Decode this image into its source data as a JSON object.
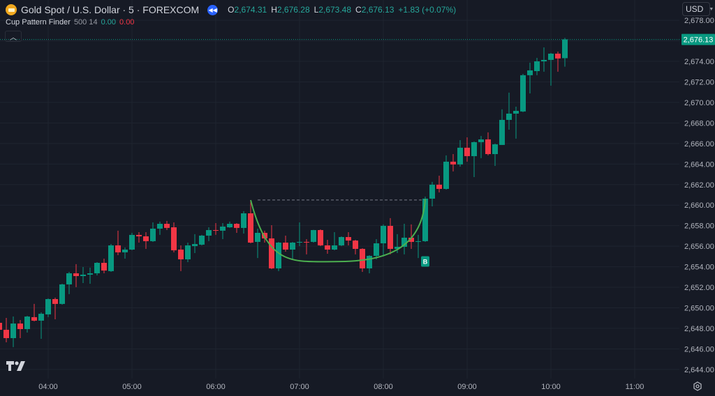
{
  "header": {
    "symbol_title": "Gold Spot / U.S. Dollar · 5 · FOREXCOM",
    "symbol_icon": "gold-bars-icon",
    "replay_icon": "rewind-icon",
    "ohlc": {
      "o_label": "O",
      "o": "2,674.31",
      "h_label": "H",
      "h": "2,676.28",
      "l_label": "L",
      "l": "2,673.48",
      "c_label": "C",
      "c": "2,676.13",
      "change": "+1.83 (+0.07%)"
    }
  },
  "indicator": {
    "name": "Cup Pattern Finder",
    "params": "500 14",
    "value1": "0.00",
    "value2": "0.00"
  },
  "currency_button": "USD",
  "colors": {
    "background": "#161a25",
    "up": "#089981",
    "down": "#f23645",
    "cup": "#4caf50",
    "grid": "#1f2430",
    "text": "#b2b5be"
  },
  "chart_data": {
    "type": "candlestick",
    "title": "",
    "timeframe": "5",
    "x_tick_labels": [
      "04:00",
      "05:00",
      "06:00",
      "07:00",
      "08:00",
      "09:00",
      "10:00",
      "11:00"
    ],
    "y_tick_labels": [
      "2,644.00",
      "2,646.00",
      "2,648.00",
      "2,650.00",
      "2,652.00",
      "2,654.00",
      "2,656.00",
      "2,658.00",
      "2,660.00",
      "2,662.00",
      "2,664.00",
      "2,666.00",
      "2,668.00",
      "2,670.00",
      "2,672.00",
      "2,674.00",
      "2,676.00",
      "2,678.00"
    ],
    "ylim": [
      2643,
      2678.5
    ],
    "grid": true,
    "last_price": 2676.13,
    "last_price_label": "2,676.13",
    "candles_fields": [
      "time",
      "open",
      "high",
      "low",
      "close"
    ],
    "candles": [
      [
        "03:25",
        2648.54,
        2648.75,
        2647.66,
        2647.86
      ],
      [
        "03:30",
        2647.86,
        2649.02,
        2646.64,
        2647.05
      ],
      [
        "03:35",
        2647.05,
        2649.15,
        2646.17,
        2648.47
      ],
      [
        "03:40",
        2648.47,
        2648.81,
        2647.05,
        2647.93
      ],
      [
        "03:45",
        2647.93,
        2649.22,
        2647.59,
        2649.15
      ],
      [
        "03:50",
        2649.09,
        2650.38,
        2648.68,
        2648.75
      ],
      [
        "03:55",
        2648.75,
        2649.56,
        2646.98,
        2649.42
      ],
      [
        "04:00",
        2649.36,
        2650.92,
        2649.09,
        2650.85
      ],
      [
        "04:05",
        2650.85,
        2650.99,
        2648.88,
        2650.38
      ],
      [
        "04:10",
        2650.38,
        2652.34,
        2650.31,
        2652.28
      ],
      [
        "04:15",
        2652.28,
        2653.5,
        2651.33,
        2653.36
      ],
      [
        "04:20",
        2653.36,
        2654.25,
        2652.01,
        2653.09
      ],
      [
        "04:25",
        2653.09,
        2653.97,
        2652.41,
        2653.23
      ],
      [
        "04:30",
        2653.23,
        2653.91,
        2652.34,
        2653.36
      ],
      [
        "04:35",
        2653.36,
        2654.45,
        2653.16,
        2654.38
      ],
      [
        "04:40",
        2654.38,
        2654.79,
        2653.36,
        2653.63
      ],
      [
        "04:45",
        2653.57,
        2656.21,
        2653.5,
        2656.08
      ],
      [
        "04:50",
        2656.08,
        2657.51,
        2655.13,
        2655.4
      ],
      [
        "04:55",
        2655.4,
        2655.88,
        2654.79,
        2655.67
      ],
      [
        "05:00",
        2655.67,
        2657.3,
        2655.6,
        2657.1
      ],
      [
        "05:05",
        2657.1,
        2657.37,
        2656.35,
        2656.96
      ],
      [
        "05:10",
        2656.96,
        2657.37,
        2655.74,
        2656.49
      ],
      [
        "05:15",
        2656.49,
        2658.32,
        2656.42,
        2657.71
      ],
      [
        "05:20",
        2657.71,
        2658.39,
        2657.1,
        2658.18
      ],
      [
        "05:25",
        2658.18,
        2658.46,
        2657.57,
        2657.78
      ],
      [
        "05:30",
        2657.84,
        2658.32,
        2655.4,
        2655.6
      ],
      [
        "05:35",
        2655.67,
        2656.08,
        2653.57,
        2654.72
      ],
      [
        "05:40",
        2654.72,
        2656.35,
        2654.45,
        2656.08
      ],
      [
        "05:45",
        2656.01,
        2657.17,
        2655.33,
        2656.21
      ],
      [
        "05:50",
        2656.15,
        2657.1,
        2656.08,
        2657.03
      ],
      [
        "05:55",
        2657.03,
        2657.84,
        2656.49,
        2657.57
      ],
      [
        "06:00",
        2657.57,
        2658.25,
        2657.1,
        2657.53
      ],
      [
        "06:05",
        2657.51,
        2658.25,
        2656.69,
        2657.91
      ],
      [
        "06:10",
        2657.84,
        2658.39,
        2657.78,
        2658.18
      ],
      [
        "06:15",
        2658.18,
        2658.25,
        2657.3,
        2657.78
      ],
      [
        "06:20",
        2657.78,
        2659.41,
        2657.23,
        2659.2
      ],
      [
        "06:25",
        2659.2,
        2660.49,
        2656.28,
        2656.35
      ],
      [
        "06:30",
        2656.42,
        2657.71,
        2654.85,
        2657.3
      ],
      [
        "06:35",
        2657.3,
        2657.51,
        2656.35,
        2656.76
      ],
      [
        "06:40",
        2656.76,
        2658.05,
        2653.77,
        2653.84
      ],
      [
        "06:45",
        2653.84,
        2656.42,
        2653.57,
        2656.35
      ],
      [
        "06:50",
        2656.35,
        2657.03,
        2655.47,
        2655.67
      ],
      [
        "06:55",
        2655.67,
        2656.42,
        2654.72,
        2656.35
      ],
      [
        "07:00",
        2656.35,
        2658.32,
        2656.01,
        2656.42
      ],
      [
        "07:05",
        2656.42,
        2656.69,
        2655.2,
        2656.38
      ],
      [
        "07:10",
        2656.42,
        2657.6,
        2656.35,
        2657.57
      ],
      [
        "07:15",
        2657.57,
        2657.64,
        2656.01,
        2656.08
      ],
      [
        "07:20",
        2656.08,
        2656.62,
        2655.26,
        2655.67
      ],
      [
        "07:25",
        2655.67,
        2657.37,
        2655.6,
        2656.08
      ],
      [
        "07:30",
        2656.08,
        2656.96,
        2656.01,
        2656.89
      ],
      [
        "07:35",
        2656.89,
        2657.37,
        2656.08,
        2656.55
      ],
      [
        "07:40",
        2656.55,
        2656.62,
        2655.2,
        2655.74
      ],
      [
        "07:45",
        2655.74,
        2655.81,
        2653.5,
        2653.84
      ],
      [
        "07:50",
        2653.84,
        2655.13,
        2653.36,
        2655.06
      ],
      [
        "07:55",
        2655.06,
        2656.69,
        2654.72,
        2656.28
      ],
      [
        "08:00",
        2656.28,
        2658.12,
        2654.99,
        2657.98
      ],
      [
        "08:05",
        2657.98,
        2658.73,
        2655.2,
        2655.74
      ],
      [
        "08:10",
        2655.74,
        2657.17,
        2655.33,
        2655.94
      ],
      [
        "08:15",
        2655.94,
        2658.18,
        2655.2,
        2656.83
      ],
      [
        "08:20",
        2656.83,
        2658.12,
        2655.74,
        2656.42
      ],
      [
        "08:25",
        2656.42,
        2657.1,
        2654.85,
        2656.49
      ],
      [
        "08:30",
        2656.49,
        2660.83,
        2656.42,
        2660.63
      ],
      [
        "08:35",
        2660.63,
        2662.26,
        2659.88,
        2661.99
      ],
      [
        "08:40",
        2661.99,
        2662.87,
        2661.24,
        2661.58
      ],
      [
        "08:45",
        2661.58,
        2664.84,
        2661.51,
        2664.23
      ],
      [
        "08:50",
        2664.23,
        2664.97,
        2663.28,
        2663.96
      ],
      [
        "08:55",
        2663.96,
        2666.33,
        2663.75,
        2665.59
      ],
      [
        "09:00",
        2665.59,
        2666.6,
        2664.23,
        2664.77
      ],
      [
        "09:05",
        2664.77,
        2666.2,
        2662.73,
        2666.13
      ],
      [
        "09:10",
        2666.13,
        2666.74,
        2664.57,
        2666.4
      ],
      [
        "09:15",
        2666.4,
        2667.08,
        2664.84,
        2664.97
      ],
      [
        "09:20",
        2664.97,
        2665.99,
        2663.82,
        2665.92
      ],
      [
        "09:25",
        2665.86,
        2669.32,
        2665.86,
        2668.3
      ],
      [
        "09:30",
        2668.3,
        2670.95,
        2667.35,
        2668.91
      ],
      [
        "09:35",
        2668.91,
        2669.59,
        2666.47,
        2669.18
      ],
      [
        "09:40",
        2669.12,
        2672.78,
        2669.05,
        2672.65
      ],
      [
        "09:45",
        2672.65,
        2673.87,
        2670.88,
        2673.12
      ],
      [
        "09:50",
        2673.05,
        2674.34,
        2672.65,
        2674.0
      ],
      [
        "09:55",
        2674.0,
        2675.36,
        2672.99,
        2674.14
      ],
      [
        "10:00",
        2674.14,
        2674.82,
        2671.63,
        2674.75
      ],
      [
        "10:05",
        2674.75,
        2674.95,
        2672.99,
        2674.28
      ],
      [
        "10:10",
        2674.31,
        2676.28,
        2673.48,
        2676.13
      ]
    ],
    "cup_pattern": {
      "start": {
        "time": "06:25",
        "price": 2660.49
      },
      "bottom": {
        "time": "07:25",
        "price": 2654.5
      },
      "end": {
        "time": "08:30",
        "price": 2660.6
      },
      "breakout_level": 2660.5,
      "signal": {
        "time": "08:30",
        "label": "B",
        "price": 2655.7
      }
    }
  },
  "footer": {
    "logo": "TV",
    "settings_icon": "gear-icon"
  }
}
